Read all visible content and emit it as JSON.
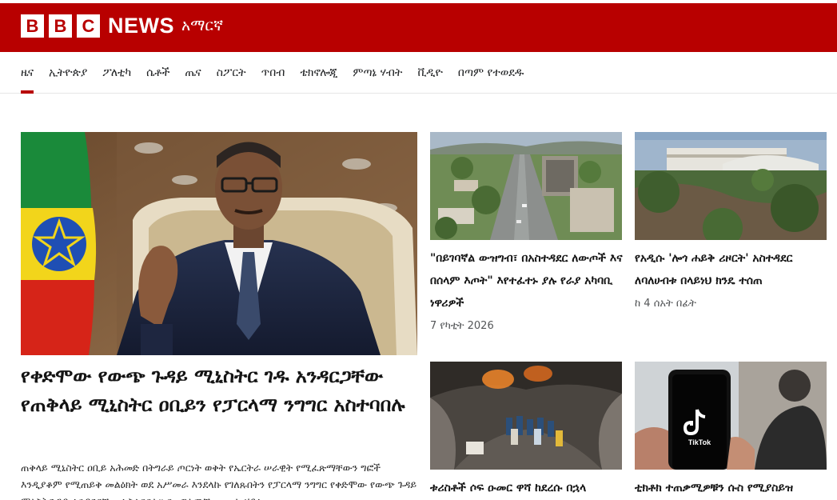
{
  "brand": {
    "blocks": [
      "B",
      "B",
      "C"
    ],
    "news": "NEWS",
    "language": "አማርኛ",
    "brand_color": "#b80000"
  },
  "nav": {
    "items": [
      "ዜና",
      "ኢትዮጵያ",
      "ፖለቲካ",
      "ሴቶች",
      "ጤና",
      "ስፖርት",
      "ጥበብ",
      "ቴክኖሎጂ",
      "ምጣኔ ሃብት",
      "ቪዲዮ",
      "በጣም የተወደዱ"
    ],
    "active_index": 0
  },
  "lead": {
    "title": "የቀድሞው የውጭ ጉዳይ ሚኒስትር ገዱ አንዳርጋቸው የጠቅላይ ሚኒስትር ዐቢይን የፓርላማ ንግግር አስተባበሉ",
    "summary": "ጠቅላይ ሚኒስትር ዐቢይ አሕመድ በትግራይ ጦርነት ወቅት የኤርትራ ሠራዊት የሚፈጽማቸውን ግፎች እንዲያቆም የሚጠይቅ መልዕክት ወደ አሥመራ እንደላኩ የገለጹበትን የፓርላማ ንግግር የቀድሞው የውጭ ጉዳይ ሚኒስትር ገዱ አንዳርጋቸው አስተባበሉ። በመግለጫቸው ሙሉ ሂደቱ"
  },
  "cards": [
    {
      "title": "\"በይገባኛል ውዝግብ፣ በአስተዳደር ለውጦች እና በሰላም እጦት\" እየተፈተኑ ያሉ የራያ አካባቢ ነዋሪዎች",
      "time": "7 የካቲት 2026"
    },
    {
      "title": "የአዲሱ 'ሎጎ ሐይቅ ሪዞርት' አስተዳደር ለባለሀብቱ በላይነህ ክንዴ ተሰጠ",
      "time": "ከ 4 ሰአት በፊት"
    },
    {
      "title": "ቱሪስቶች ሶፍ ዑመር ዋሻ ከደረሱ በኋላ",
      "time": ""
    },
    {
      "title": "ቲክቶክ ተጠቃሚዎቹን ሱስ የሚያስይዝ",
      "time": ""
    }
  ],
  "labels": {
    "tiktok_text": "TikTok"
  }
}
